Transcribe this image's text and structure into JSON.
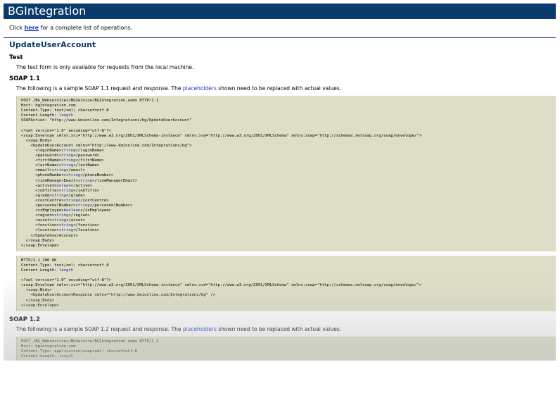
{
  "banner": {
    "title": "BGIntegration"
  },
  "intro": {
    "prefix": "Click ",
    "link": "here",
    "suffix": " for a complete list of operations."
  },
  "operation": {
    "title": "UpdateUserAccount"
  },
  "test": {
    "heading": "Test",
    "text": "The test form is only available for requests from the local machine."
  },
  "soap11": {
    "heading": "SOAP 1.1",
    "desc_prefix": "The following is a sample SOAP 1.1 request and response. The ",
    "desc_link": "placeholders",
    "desc_suffix": " shown need to be replaced with actual values.",
    "request_lines": [
      "POST /BG_Webservices/BGService/BGIntegration.asmx HTTP/1.1",
      "Host: bgintegration.com",
      "Content-Type: text/xml; charset=utf-8",
      "Content-Length: {{length}}",
      "SOAPAction: \"http://www.kmionline.com/Integrations/bg/UpdateUserAccount\"",
      "",
      "<?xml version=\"1.0\" encoding=\"utf-8\"?>",
      "<soap:Envelope xmlns:xsi=\"http://www.w3.org/2001/XMLSchema-instance\" xmlns:xsd=\"http://www.w3.org/2001/XMLSchema\" xmlns:soap=\"http://schemas.xmlsoap.org/soap/envelope/\">",
      "  <soap:Body>",
      "    <UpdateUserAccount xmlns=\"http://www.kmionline.com/Integrations/bg\">",
      "      <loginName>{{string}}</loginName>",
      "      <password>{{string}}</password>",
      "      <firstName>{{string}}</firstName>",
      "      <lastName>{{string}}</lastName>",
      "      <email>{{string}}</email>",
      "      <phoneNumber>{{string}}</phoneNumber>",
      "      <lineManagerEmail>{{string}}</lineManagerEmail>",
      "      <active>{{boolean}}</active>",
      "      <jobTitle>{{string}}</jobTitle>",
      "      <grade>{{string}}</grade>",
      "      <costCentre>{{string}}</costCentre>",
      "      <personnelNumber>{{string}}</personnelNumber>",
      "      <isEmployee>{{boolean}}</isEmployee>",
      "      <region>{{string}}</region>",
      "      <asset>{{string}}</asset>",
      "      <function>{{string}}</function>",
      "      <location>{{string}}</location>",
      "    </UpdateUserAccount>",
      "  </soap:Body>",
      "</soap:Envelope>"
    ],
    "response_lines": [
      "HTTP/1.1 200 OK",
      "Content-Type: text/xml; charset=utf-8",
      "Content-Length: {{length}}",
      "",
      "<?xml version=\"1.0\" encoding=\"utf-8\"?>",
      "<soap:Envelope xmlns:xsi=\"http://www.w3.org/2001/XMLSchema-instance\" xmlns:xsd=\"http://www.w3.org/2001/XMLSchema\" xmlns:soap=\"http://schemas.xmlsoap.org/soap/envelope/\">",
      "  <soap:Body>",
      "    <UpdateUserAccountResponse xmlns=\"http://www.kmionline.com/Integrations/bg\" />",
      "  </soap:Body>",
      "</soap:Envelope>"
    ]
  },
  "soap12": {
    "heading": "SOAP 1.2",
    "desc_prefix": "The following is a sample SOAP 1.2 request and response. The ",
    "desc_link": "placeholders",
    "desc_suffix": " shown need to be replaced with actual values.",
    "request_lines": [
      "POST /BG_Webservices/BGService/BGIntegration.asmx HTTP/1.1",
      "Host: bgintegration.com",
      "Content-Type: application/soap+xml; charset=utf-8",
      "Content-Length: {{length}}"
    ]
  },
  "colors": {
    "banner": "#0b3a6c",
    "link": "#1a36c8",
    "code_bg": "#dedec6"
  }
}
